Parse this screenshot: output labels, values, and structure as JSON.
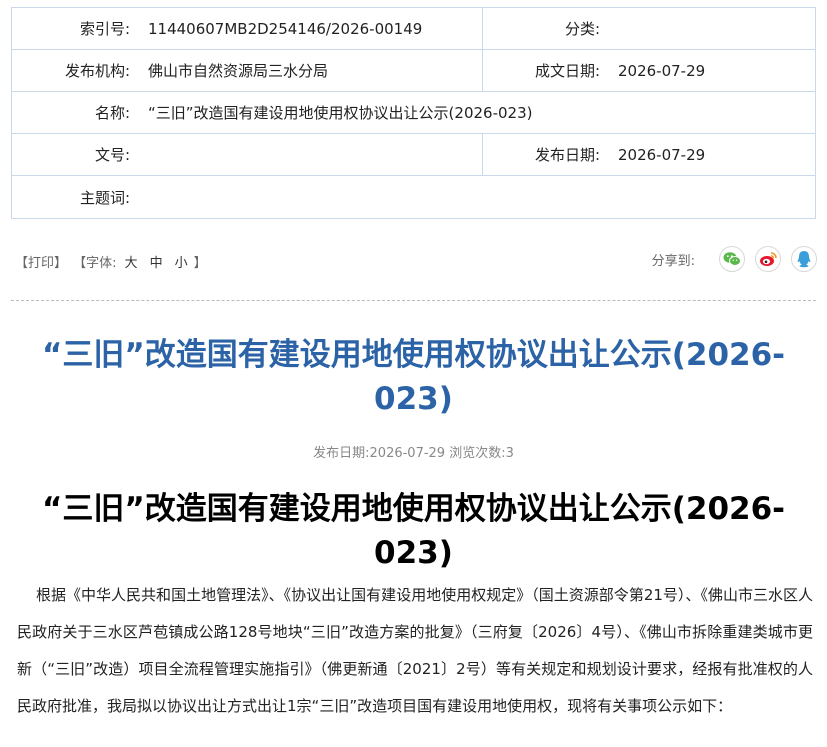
{
  "meta": {
    "index_label": "索引号:",
    "index_value": "11440607MB2D254146/2026-00149",
    "category_label": "分类:",
    "category_value": "",
    "publisher_label": "发布机构:",
    "publisher_value": "佛山市自然资源局三水分局",
    "created_date_label": "成文日期:",
    "created_date_value": "2026-07-29",
    "name_label": "名称:",
    "name_value": "“三旧”改造国有建设用地使用权协议出让公示(2026-023)",
    "doc_no_label": "文号:",
    "doc_no_value": "",
    "publish_date_label": "发布日期:",
    "publish_date_value": "2026-07-29",
    "keywords_label": "主题词:",
    "keywords_value": ""
  },
  "tools": {
    "print": "【打印】",
    "font_open": "【字体:",
    "font_large": "大",
    "font_medium": "中",
    "font_small": "小",
    "font_close": "】"
  },
  "share": {
    "label": "分享到:",
    "icons": [
      "wechat-icon",
      "weibo-icon",
      "qq-icon"
    ],
    "colors": {
      "wechat": "#5bb84a",
      "weibo": "#e6162d",
      "qq": "#3a9fd9"
    }
  },
  "article": {
    "title": "“三旧”改造国有建设用地使用权协议出让公示(2026-023)",
    "pub_info": "发布日期:2026-07-29  浏览次数:3",
    "title_repeat": "“三旧”改造国有建设用地使用权协议出让公示(2026-023)",
    "paragraph": "根据《中华人民共和国土地管理法》、《协议出让国有建设用地使用权规定》（国土资源部令第21号）、《佛山市三水区人民政府关于三水区芦苞镇成公路128号地块“三旧”改造方案的批复》（三府复〔2026〕4号）、《佛山市拆除重建类城市更新（“三旧”改造）项目全流程管理实施指引》（佛更新通〔2021〕2号）等有关规定和规划设计要求，经报有批准权的人民政府批准，我局拟以协议出让方式出让1宗“三旧”改造项目国有建设用地使用权，现将有关事项公示如下："
  },
  "colors": {
    "title_blue": "#2b63a6",
    "border": "#c9d9ea"
  }
}
